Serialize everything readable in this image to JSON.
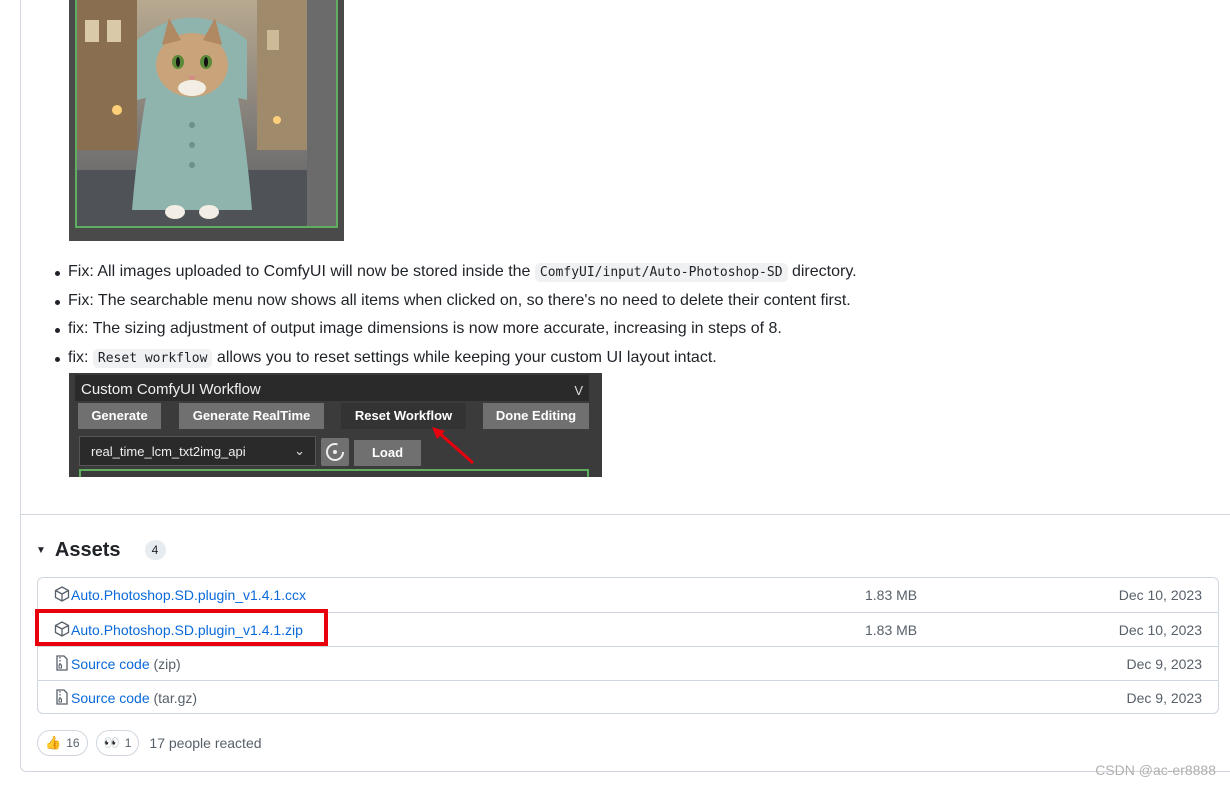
{
  "bullets": [
    {
      "before": "Fix: All images uploaded to ComfyUI will now be stored inside the ",
      "code": "ComfyUI/input/Auto-Photoshop-SD",
      "after": " directory."
    },
    {
      "before": "Fix: The searchable menu now shows all items when clicked on, so there's no need to delete their content first.",
      "code": "",
      "after": ""
    },
    {
      "before": "fix: The sizing adjustment of output image dimensions is now more accurate, increasing in steps of 8.",
      "code": "",
      "after": ""
    },
    {
      "before": "fix: ",
      "code": "Reset workflow",
      "after": " allows you to reset settings while keeping your custom UI layout intact."
    }
  ],
  "comfy": {
    "title": "Custom ComfyUI Workflow",
    "collapse": "V",
    "buttons": [
      "Generate",
      "Generate RealTime",
      "Reset Workflow",
      "Done Editing"
    ],
    "select_value": "real_time_lcm_txt2img_api",
    "load_label": "Load"
  },
  "assets": {
    "title": "Assets",
    "count": "4",
    "rows": [
      {
        "name": "Auto.Photoshop.SD.plugin_v1.4.1.ccx",
        "ext": "",
        "size": "1.83 MB",
        "date": "Dec 10, 2023",
        "icon": "package-icon"
      },
      {
        "name": "Auto.Photoshop.SD.plugin_v1.4.1.zip",
        "ext": "",
        "size": "1.83 MB",
        "date": "Dec 10, 2023",
        "icon": "package-icon"
      },
      {
        "name": "Source code",
        "ext": "(zip)",
        "size": "",
        "date": "Dec 9, 2023",
        "icon": "file-zip-icon"
      },
      {
        "name": "Source code",
        "ext": "(tar.gz)",
        "size": "",
        "date": "Dec 9, 2023",
        "icon": "file-zip-icon"
      }
    ]
  },
  "reactions": {
    "thumbs_count": "16",
    "eyes_count": "1",
    "summary": "17 people reacted"
  },
  "watermark": "CSDN @ac-er8888",
  "colors": {
    "link": "#0969da",
    "highlight": "#e8000d",
    "comfy_green": "#5fae5f"
  }
}
